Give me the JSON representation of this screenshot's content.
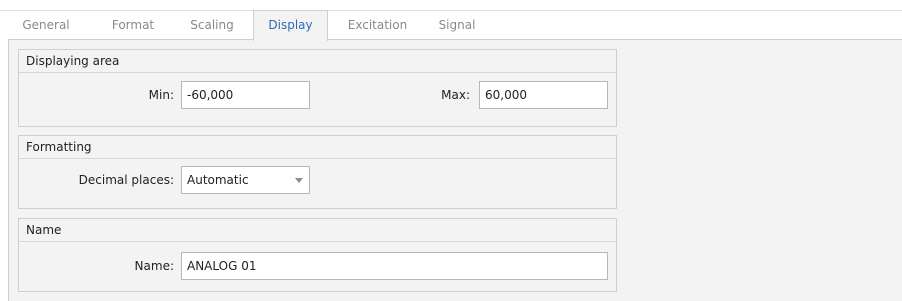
{
  "tabs": [
    {
      "label": "General",
      "active": false
    },
    {
      "label": "Format",
      "active": false
    },
    {
      "label": "Scaling",
      "active": false
    },
    {
      "label": "Display",
      "active": true
    },
    {
      "label": "Excitation",
      "active": false
    },
    {
      "label": "Signal",
      "active": false
    }
  ],
  "colors": {
    "active_tab_text": "#2e6bb5",
    "inactive_tab_text": "#8a8a8a",
    "panel_background": "#f3f3f3"
  },
  "displaying_area": {
    "title": "Displaying area",
    "min_label": "Min:",
    "min_value": "-60,000",
    "max_label": "Max:",
    "max_value": "60,000"
  },
  "formatting": {
    "title": "Formatting",
    "decimal_places_label": "Decimal places:",
    "decimal_places_value": "Automatic",
    "dropdown_icon": "chevron-down-icon"
  },
  "name_section": {
    "title": "Name",
    "name_label": "Name:",
    "name_value": "ANALOG 01"
  }
}
